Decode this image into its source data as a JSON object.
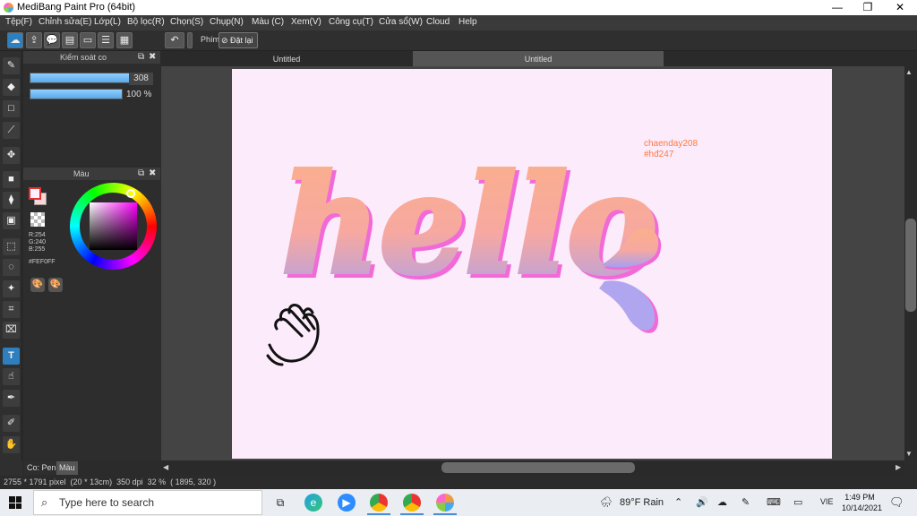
{
  "window": {
    "title": "MediBang Paint Pro (64bit)",
    "minimize": "—",
    "maximize": "❐",
    "close": "✕"
  },
  "menu": [
    "Tệp(F)",
    "Chỉnh sửa(E)",
    "Lớp(L)",
    "Bộ lọc(R)",
    "Chọn(S)",
    "Chụp(N)",
    "Màu (C)",
    "Xem(V)",
    "Công cụ(T)",
    "Cửa sổ(W)",
    "Cloud",
    "Help"
  ],
  "toolbar": {
    "filter_label": "Phím",
    "reset_label": "Đặt lại"
  },
  "brush_panel": {
    "title": "Kiểm soát co",
    "size_value": "308",
    "size_fraction": 1.0,
    "opacity_value": "100 %",
    "opacity_fraction": 1.0
  },
  "color_panel": {
    "title": "Màu",
    "r_label": "R:254",
    "g_label": "G:240",
    "b_label": "B:255",
    "hex_label": "#FEF0FF",
    "foreground": "#fef0ff",
    "accent": "#e03030"
  },
  "tabs": [
    {
      "label": "Untitled"
    },
    {
      "label": "Untitled"
    }
  ],
  "canvas": {
    "background": "#fcebfb",
    "word": "hello",
    "credit_line1": "chaenday208",
    "credit_line2": "#hđ247",
    "credit_color": "#ff7a3d"
  },
  "panel_tabs": {
    "pen": "Co: Pen",
    "color": "Màu"
  },
  "status": {
    "dimensions": "2755 * 1791 pixel  (20 * 13cm)  350 dpi  32 %  ( 1895, 320 )"
  },
  "taskbar": {
    "search_placeholder": "Type here to search",
    "weather": "89°F  Rain",
    "lang": "VIE",
    "time": "1:49 PM",
    "date": "10/14/2021"
  }
}
